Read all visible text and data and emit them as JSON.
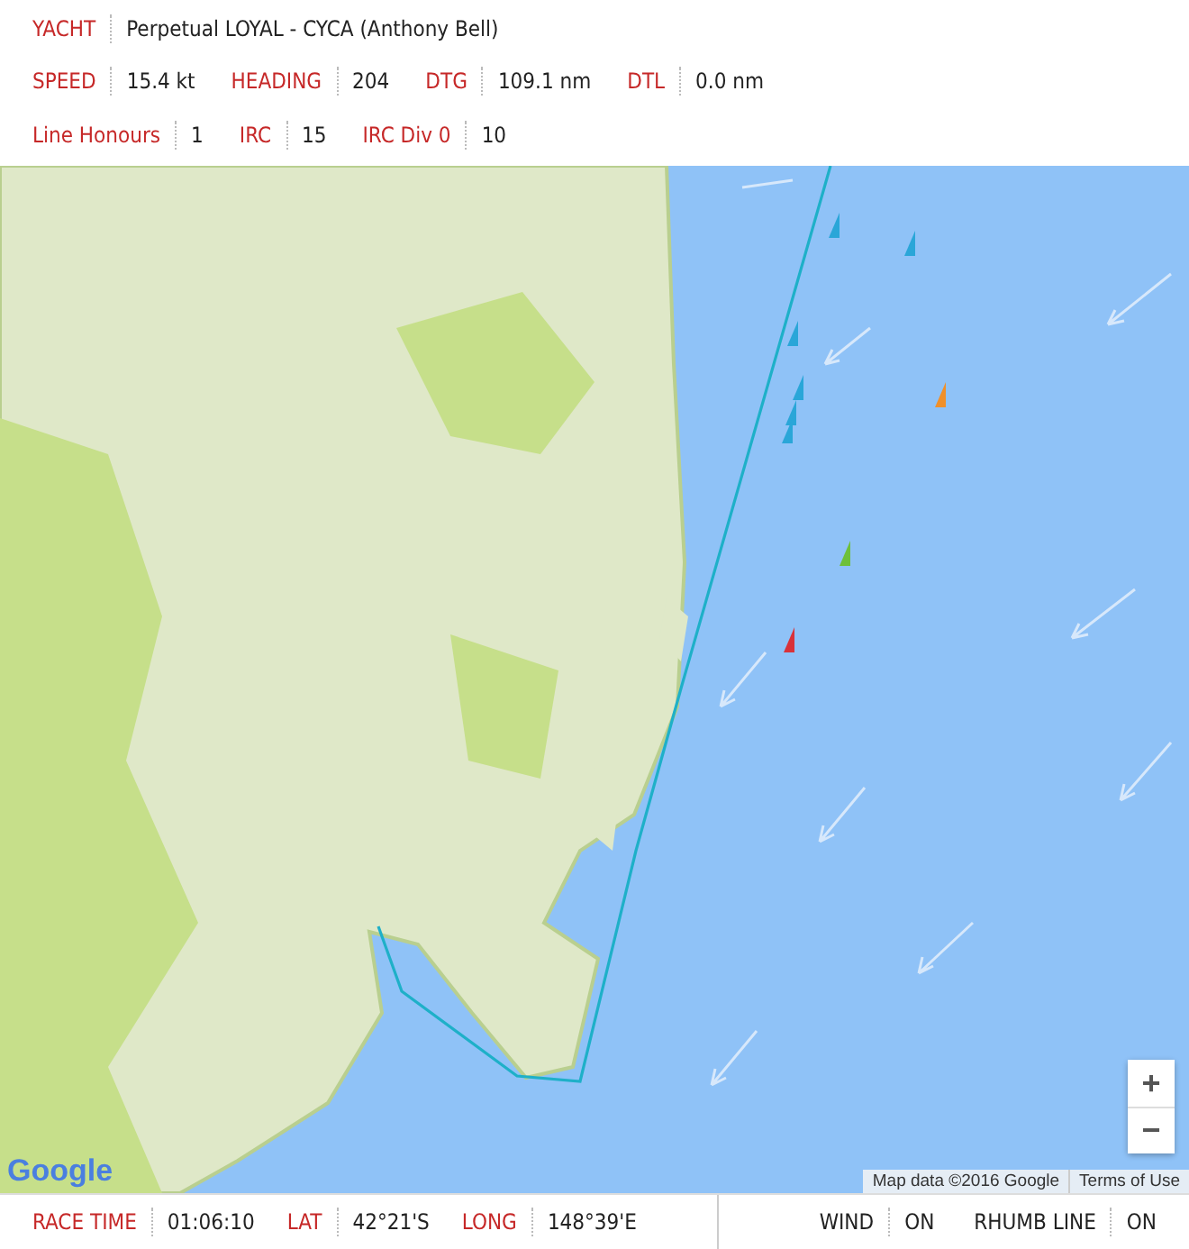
{
  "yacht": {
    "label": "YACHT",
    "value": "Perpetual LOYAL - CYCA (Anthony Bell)"
  },
  "stats": [
    {
      "label": "SPEED",
      "value": "15.4 kt"
    },
    {
      "label": "HEADING",
      "value": "204"
    },
    {
      "label": "DTG",
      "value": "109.1 nm"
    },
    {
      "label": "DTL",
      "value": "0.0 nm"
    }
  ],
  "rankings": [
    {
      "label": "Line Honours",
      "value": "1"
    },
    {
      "label": "IRC",
      "value": "15"
    },
    {
      "label": "IRC Div 0",
      "value": "10"
    }
  ],
  "map": {
    "zoom_in": "+",
    "zoom_out": "−",
    "logo": "Google",
    "attribution": "Map data ©2016 Google",
    "terms": "Terms of Use"
  },
  "footer": {
    "readings": [
      {
        "label": "RACE TIME",
        "value": "01:06:10"
      },
      {
        "label": "LAT",
        "value": "42°21'S"
      },
      {
        "label": "LONG",
        "value": "148°39'E"
      }
    ],
    "toggles": [
      {
        "label": "WIND",
        "value": "ON",
        "on": true
      },
      {
        "label": "RHUMB LINE",
        "value": "ON",
        "on": true
      }
    ]
  }
}
